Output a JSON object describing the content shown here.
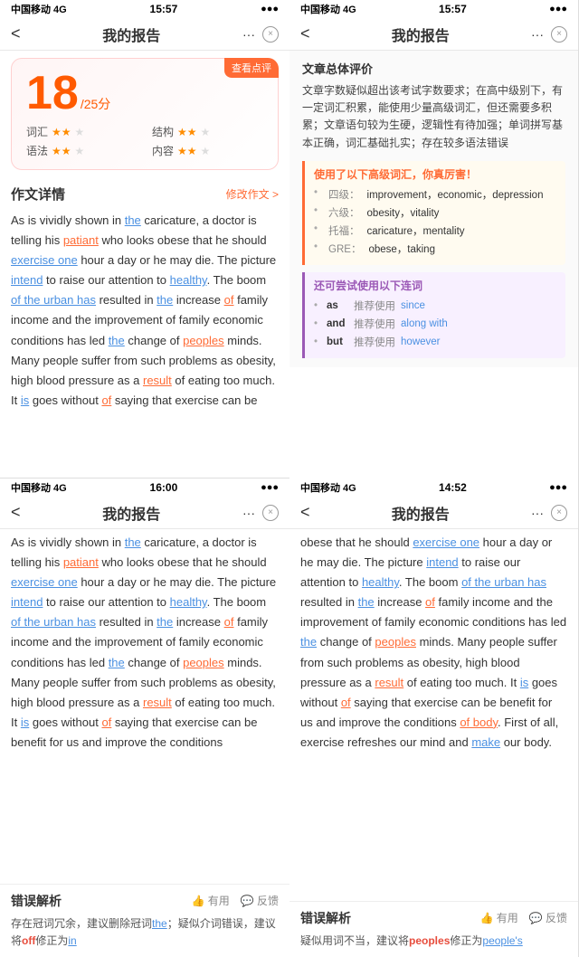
{
  "panel1": {
    "status": {
      "carrier": "中国移动 4G",
      "time": "15:57",
      "right": ""
    },
    "nav": {
      "title": "我的报告",
      "back": "<",
      "more": "···",
      "close": "×"
    },
    "score": {
      "badge": "查看点评",
      "value": "18",
      "total": "/25分",
      "metrics": [
        {
          "label": "词汇",
          "stars": 2,
          "max": 3
        },
        {
          "label": "结构",
          "stars": 2,
          "max": 3
        },
        {
          "label": "语法",
          "stars": 2,
          "max": 3
        },
        {
          "label": "内容",
          "stars": 2,
          "max": 3
        }
      ]
    },
    "section": {
      "title": "作文详情",
      "action": "修改作文 >"
    },
    "essay": "As is vividly shown in the caricature, a doctor is telling his patiant who looks obese that he should exercise one hour a day or he may die. The picture intend to raise our attention to healthy. The boom of the urban has resulted in the increase of family income and the improvement of family economic conditions has led the change of peoples minds. Many people suffer from such problems as obesity, high blood pressure as a result of eating too much. It is goes without of saying that exercise can be"
  },
  "panel2": {
    "status": {
      "carrier": "中国移动 4G",
      "time": "15:57",
      "right": ""
    },
    "nav": {
      "title": "我的报告",
      "back": "<",
      "more": "···",
      "close": "×"
    },
    "overall_title": "文章总体评价",
    "overall_text": "文章字数疑似超出该考试字数要求；在高中级别下，有一定词汇积累，能使用少量高级词汇，但还需要多积累；文章语句较为生硬，逻辑性有待加强；单词拼写基本正确，词汇基础扎实；存在较多语法错误",
    "vocab_title": "使用了以下高级词汇，你真厉害！",
    "vocab_items": [
      {
        "level": "四级：",
        "words": "improvement，economic，depression"
      },
      {
        "level": "六级：",
        "words": "obesity，vitality"
      },
      {
        "level": "托福：",
        "words": "caricature，mentality"
      },
      {
        "level": "GRE：",
        "words": "obese，taking"
      }
    ],
    "connector_title": "还可尝试使用以下连词",
    "connector_items": [
      {
        "word": "as",
        "label": "推荐使用",
        "suggest": "since"
      },
      {
        "word": "and",
        "label": "推荐使用",
        "suggest": "along with"
      },
      {
        "word": "but",
        "label": "推荐使用",
        "suggest": "however"
      }
    ]
  },
  "panel3": {
    "status": {
      "carrier": "中国移动 4G",
      "time": "16:00",
      "right": ""
    },
    "nav": {
      "title": "我的报告",
      "back": "<",
      "more": "···",
      "close": "×"
    },
    "essay": "As is vividly shown in the caricature, a doctor is telling his patiant who looks obese that he should exercise one hour a day or he may die. The picture intend to raise our attention to healthy. The boom of the urban has resulted in the increase of family income and the improvement of family economic conditions has led the change of peoples minds. Many people suffer from such problems as obesity, high blood pressure as a result of eating too much. It is goes without of saying that exercise can be benefit for us and improve the conditions",
    "error": {
      "title": "错误解析",
      "actions": [
        "有用",
        "反馈"
      ],
      "text": "存在冠词冗余，建议删除冠词the；疑似介词错误，建议将off修正为in"
    }
  },
  "panel4": {
    "status": {
      "carrier": "中国移动 4G",
      "time": "14:52",
      "right": ""
    },
    "nav": {
      "title": "我的报告",
      "back": "<",
      "more": "···",
      "close": "×"
    },
    "essay": "obese that he should exercise one hour a day or he may die. The picture intend to raise our attention to healthy. The boom of the urban has resulted in the increase of family income and the improvement of family economic conditions has led the change of peoples minds. Many people suffer from such problems as obesity, high blood pressure as a result of eating too much. It is goes without of saying that exercise can be benefit for us and improve the conditions of body. First of all, exercise refreshes our mind and make our body.",
    "error": {
      "title": "错误解析",
      "actions": [
        "有用",
        "反馈"
      ],
      "text": "疑似用词不当，建议将peoples修正为people's"
    }
  }
}
